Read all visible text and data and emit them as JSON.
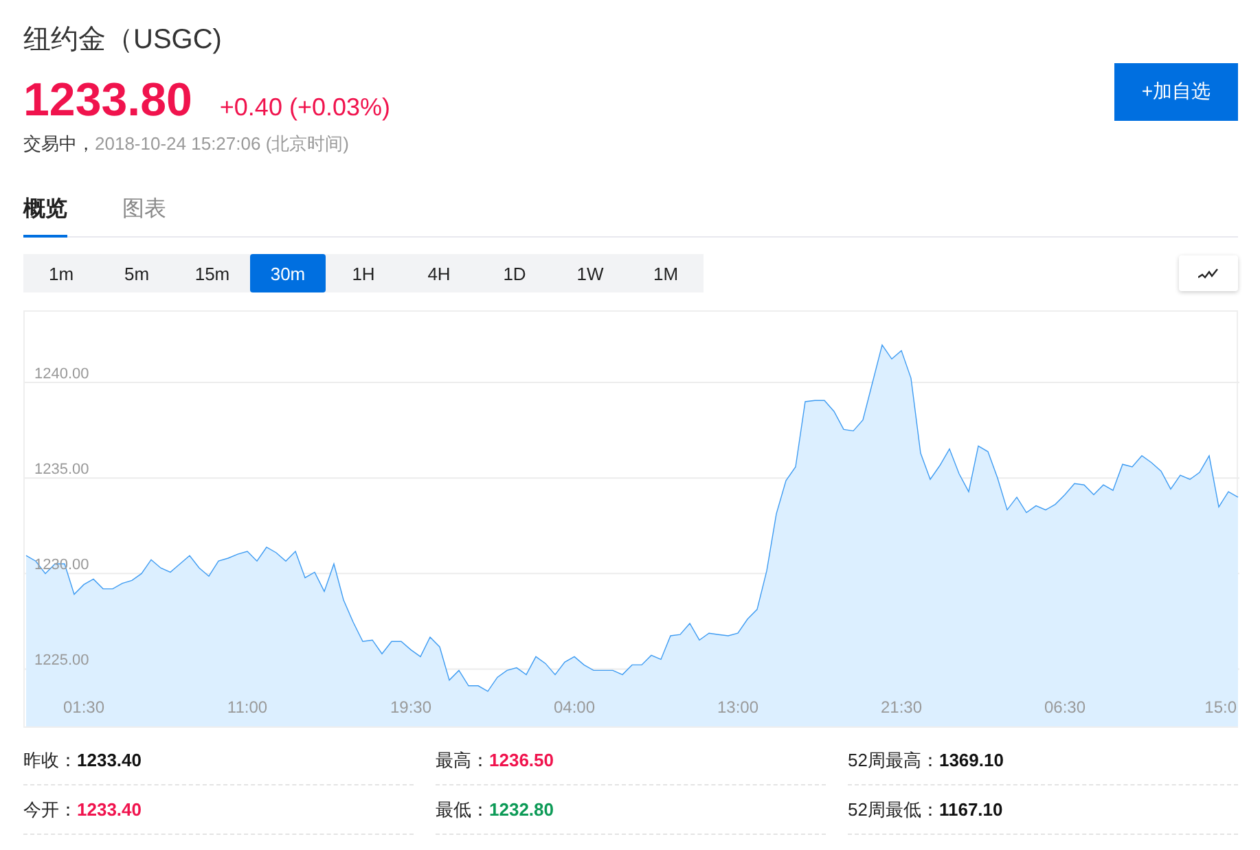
{
  "header": {
    "title": "纽约金（USGC)",
    "price": "1233.80",
    "change": "+0.40 (+0.03%)",
    "status": "交易中，",
    "timestamp": "2018-10-24 15:27:06 (北京时间)",
    "watch_button": "+加自选"
  },
  "tabs": [
    {
      "label": "概览",
      "selected": true
    },
    {
      "label": "图表",
      "selected": false
    }
  ],
  "intervals": [
    {
      "label": "1m",
      "selected": false
    },
    {
      "label": "5m",
      "selected": false
    },
    {
      "label": "15m",
      "selected": false
    },
    {
      "label": "30m",
      "selected": true
    },
    {
      "label": "1H",
      "selected": false
    },
    {
      "label": "4H",
      "selected": false
    },
    {
      "label": "1D",
      "selected": false
    },
    {
      "label": "1W",
      "selected": false
    },
    {
      "label": "1M",
      "selected": false
    }
  ],
  "chart": {
    "chart_data": {
      "type": "area",
      "grid": true,
      "categories": [
        null,
        null,
        null,
        null,
        null,
        null,
        "01:30",
        null,
        null,
        null,
        null,
        null,
        null,
        null,
        null,
        null,
        null,
        null,
        null,
        null,
        null,
        null,
        null,
        "11:00",
        null,
        null,
        null,
        null,
        null,
        null,
        null,
        null,
        null,
        null,
        null,
        null,
        null,
        null,
        null,
        null,
        "19:30",
        null,
        null,
        null,
        null,
        null,
        null,
        null,
        null,
        null,
        null,
        null,
        null,
        null,
        null,
        null,
        null,
        "04:00",
        null,
        null,
        null,
        null,
        null,
        null,
        null,
        null,
        null,
        null,
        null,
        null,
        null,
        null,
        null,
        null,
        "13:00",
        null,
        null,
        null,
        null,
        null,
        null,
        null,
        null,
        null,
        null,
        null,
        null,
        null,
        null,
        null,
        null,
        "21:30",
        null,
        null,
        null,
        null,
        null,
        null,
        null,
        null,
        null,
        null,
        null,
        null,
        null,
        null,
        null,
        null,
        "06:30",
        null,
        null,
        null,
        null,
        null,
        null,
        null,
        null,
        null,
        null,
        null,
        null,
        null,
        null,
        null,
        null,
        "15:0",
        null
      ],
      "ylim": [
        1222,
        1243.7
      ],
      "yticks": [
        {
          "value": 1240,
          "label": "1240.00"
        },
        {
          "value": 1235,
          "label": "1235.00"
        },
        {
          "value": 1230,
          "label": "1230.00"
        },
        {
          "value": 1225,
          "label": "1225.00"
        }
      ],
      "series": [
        {
          "color": "#3d9bf2",
          "values": [
            1230.94,
            1230.65,
            1230.0,
            1230.51,
            1230.51,
            1228.91,
            1229.42,
            1229.71,
            1229.2,
            1229.2,
            1229.49,
            1229.64,
            1230.0,
            1230.72,
            1230.29,
            1230.07,
            1230.51,
            1230.94,
            1230.29,
            1229.86,
            1230.65,
            1230.8,
            1231.01,
            1231.16,
            1230.65,
            1231.38,
            1231.09,
            1230.65,
            1231.16,
            1229.78,
            1230.07,
            1229.06,
            1230.51,
            1228.62,
            1227.46,
            1226.45,
            1226.52,
            1225.8,
            1226.45,
            1226.45,
            1226.01,
            1225.65,
            1226.67,
            1226.16,
            1224.42,
            1224.93,
            1224.13,
            1224.13,
            1223.84,
            1224.57,
            1224.93,
            1225.07,
            1224.71,
            1225.65,
            1225.29,
            1224.71,
            1225.36,
            1225.65,
            1225.22,
            1224.93,
            1224.93,
            1224.93,
            1224.71,
            1225.22,
            1225.22,
            1225.72,
            1225.51,
            1226.74,
            1226.81,
            1227.39,
            1226.52,
            1226.88,
            1226.81,
            1226.74,
            1226.88,
            1227.61,
            1228.12,
            1230.14,
            1233.12,
            1234.86,
            1235.58,
            1238.99,
            1239.06,
            1239.06,
            1238.48,
            1237.54,
            1237.46,
            1238.04,
            1240.0,
            1241.96,
            1241.23,
            1241.67,
            1240.22,
            1236.3,
            1234.93,
            1235.65,
            1236.52,
            1235.22,
            1234.28,
            1236.67,
            1236.38,
            1235.0,
            1233.33,
            1233.99,
            1233.19,
            1233.55,
            1233.33,
            1233.62,
            1234.13,
            1234.71,
            1234.64,
            1234.13,
            1234.64,
            1234.35,
            1235.72,
            1235.58,
            1236.16,
            1235.8,
            1235.36,
            1234.42,
            1235.14,
            1234.93,
            1235.29,
            1236.16,
            1233.48,
            1234.28,
            1233.99
          ]
        }
      ]
    }
  },
  "stats": [
    {
      "label": "昨收：",
      "value": "1233.40",
      "color": "#111111"
    },
    {
      "label": "最高：",
      "value": "1236.50",
      "color": "#f0134d"
    },
    {
      "label": "52周最高：",
      "value": "1369.10",
      "color": "#111111"
    },
    {
      "label": "今开：",
      "value": "1233.40",
      "color": "#f0134d"
    },
    {
      "label": "最低：",
      "value": "1232.80",
      "color": "#0c9a56"
    },
    {
      "label": "52周最低：",
      "value": "1167.10",
      "color": "#111111"
    }
  ]
}
